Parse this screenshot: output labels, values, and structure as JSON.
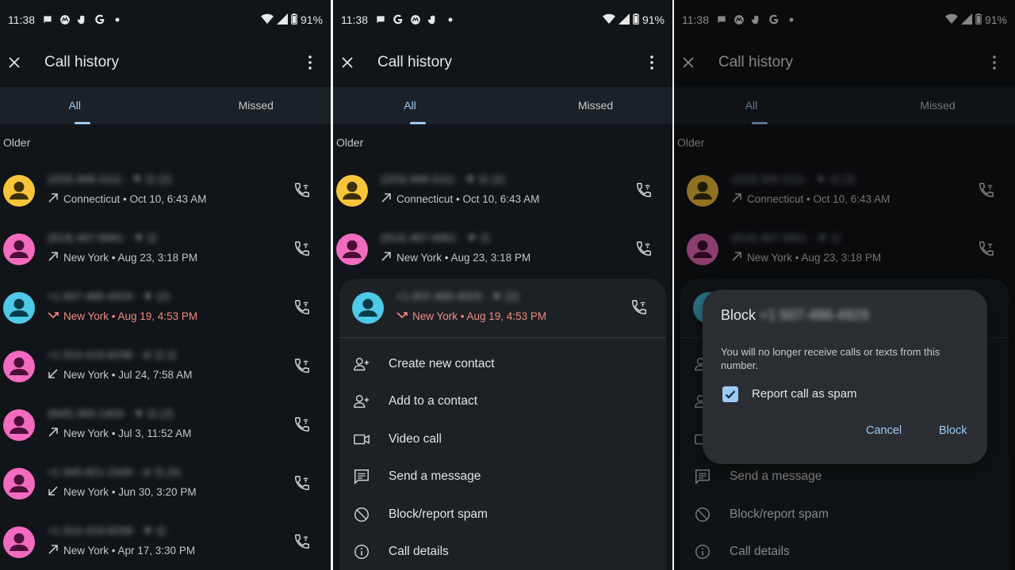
{
  "status": {
    "time": "11:38",
    "battery": "91%"
  },
  "panels": [
    {
      "appbar": {
        "title": "Call history"
      },
      "tabs": [
        {
          "label": "All"
        },
        {
          "label": "Missed"
        }
      ],
      "section": "Older",
      "calls": [
        {
          "number": "(203) 908-2111 · ▼ ⊡ (2)",
          "detail": "Connecticut • Oct 10, 6:43 AM",
          "type": "outgoing",
          "avatar_color": "#f8c53a",
          "figure_color": "#3b2f0b"
        },
        {
          "number": "(914) 467-9961 · ▼ ⊡",
          "detail": "New York • Aug 23, 3:18 PM",
          "type": "outgoing",
          "avatar_color": "#f26bc0",
          "figure_color": "#4a0f35"
        },
        {
          "number": "+1 607-486-4929 · ▼ (2)",
          "detail": "New York • Aug 19, 4:53 PM",
          "type": "missed",
          "avatar_color": "#4fc9e8",
          "figure_color": "#083a47"
        },
        {
          "number": "+1 914-419-8298 · ⊘ ⊡ ⊡",
          "detail": "New York • Jul 24, 7:58 AM",
          "type": "incoming",
          "avatar_color": "#f26bc0",
          "figure_color": "#4a0f35"
        },
        {
          "number": "(845) 360-1404 · ▼ ⊡ (2)",
          "detail": "New York • Jul 3, 11:52 AM",
          "type": "outgoing",
          "avatar_color": "#f26bc0",
          "figure_color": "#4a0f35"
        },
        {
          "number": "+1 845-821-2349 · ⊘ ⊡ (5)",
          "detail": "New York • Jun 30, 3:20 PM",
          "type": "incoming",
          "avatar_color": "#f26bc0",
          "figure_color": "#4a0f35"
        },
        {
          "number": "+1 914-419-8298 · ▼ ⊡",
          "detail": "New York • Apr 17, 3:30 PM",
          "type": "outgoing",
          "avatar_color": "#f26bc0",
          "figure_color": "#4a0f35"
        }
      ]
    },
    {
      "appbar": {
        "title": "Call history"
      },
      "tabs": [
        {
          "label": "All"
        },
        {
          "label": "Missed"
        }
      ],
      "section": "Older",
      "calls": [
        {
          "number": "(203) 908-2111 · ▼ ⊡ (2)",
          "detail": "Connecticut • Oct 10, 6:43 AM",
          "type": "outgoing",
          "avatar_color": "#f8c53a",
          "figure_color": "#3b2f0b"
        },
        {
          "number": "(914) 467-9961 · ▼ ⊡",
          "detail": "New York • Aug 23, 3:18 PM",
          "type": "outgoing",
          "avatar_color": "#f26bc0",
          "figure_color": "#4a0f35"
        }
      ],
      "expanded_call": {
        "number": "+1 607-486-4929 · ▼ (2)",
        "detail": "New York • Aug 19, 4:53 PM",
        "type": "missed",
        "avatar_color": "#4fc9e8",
        "figure_color": "#083a47"
      },
      "actions": [
        {
          "label": "Create new contact",
          "icon": "person-add-icon"
        },
        {
          "label": "Add to a contact",
          "icon": "person-add-icon"
        },
        {
          "label": "Video call",
          "icon": "video-call-icon"
        },
        {
          "label": "Send a message",
          "icon": "message-icon"
        },
        {
          "label": "Block/report spam",
          "icon": "block-icon"
        },
        {
          "label": "Call details",
          "icon": "info-icon"
        }
      ]
    },
    {
      "appbar": {
        "title": "Call history"
      },
      "tabs": [
        {
          "label": "All"
        },
        {
          "label": "Missed"
        }
      ],
      "section": "Older",
      "calls": [
        {
          "number": "(203) 908-2111 · ▼ ⊡ (2)",
          "detail": "Connecticut • Oct 10, 6:43 AM",
          "type": "outgoing",
          "avatar_color": "#f8c53a",
          "figure_color": "#3b2f0b"
        },
        {
          "number": "(914) 467-9961 · ▼ ⊡",
          "detail": "New York • Aug 23, 3:18 PM",
          "type": "outgoing",
          "avatar_color": "#f26bc0",
          "figure_color": "#4a0f35"
        }
      ],
      "actions_visible": [
        {
          "label": "Send a message",
          "icon": "message-icon"
        },
        {
          "label": "Block/report spam",
          "icon": "block-icon"
        },
        {
          "label": "Call details",
          "icon": "info-icon"
        }
      ],
      "dialog": {
        "title_prefix": "Block",
        "title_number": "+1 607-486-4929",
        "message": "You will no longer receive calls or texts from this number.",
        "checkbox_label": "Report call as spam",
        "checkbox_checked": true,
        "cancel_label": "Cancel",
        "block_label": "Block"
      }
    }
  ],
  "colors": {
    "background": "#111418",
    "tabs_bg": "#1b2227",
    "accent": "#9ccaf5",
    "missed": "#f28b82",
    "sheet_bg": "#1d2125",
    "dialog_bg": "#2a2e33"
  }
}
